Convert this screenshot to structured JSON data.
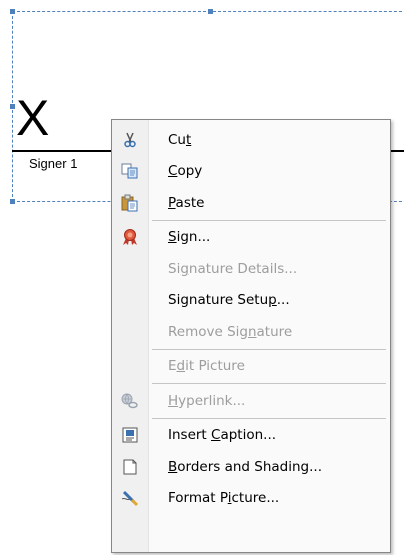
{
  "signature": {
    "mark": "X",
    "signer_label": "Signer 1"
  },
  "menu": {
    "items": [
      {
        "label": "Cut",
        "accel": "t",
        "icon": "scissors-icon",
        "enabled": true
      },
      {
        "label": "Copy",
        "accel": "C",
        "icon": "copy-icon",
        "enabled": true
      },
      {
        "label": "Paste",
        "accel": "P",
        "icon": "paste-icon",
        "enabled": true
      },
      {
        "label": "Sign...",
        "accel": "S",
        "icon": "sign-ribbon-icon",
        "enabled": true
      },
      {
        "label": "Signature Details...",
        "accel": "g",
        "icon": "",
        "enabled": false
      },
      {
        "label": "Signature Setup...",
        "accel": "p",
        "icon": "",
        "enabled": true
      },
      {
        "label": "Remove Signature",
        "accel": "n",
        "icon": "",
        "enabled": false
      },
      {
        "label": "Edit Picture",
        "accel": "d",
        "icon": "",
        "enabled": false
      },
      {
        "label": "Hyperlink...",
        "accel": "H",
        "icon": "hyperlink-icon",
        "enabled": false
      },
      {
        "label": "Insert Caption...",
        "accel": "C",
        "icon": "insert-caption-icon",
        "enabled": true
      },
      {
        "label": "Borders and Shading...",
        "accel": "B",
        "icon": "borders-icon",
        "enabled": true
      },
      {
        "label": "Format Picture...",
        "accel": "i",
        "icon": "format-picture-icon",
        "enabled": true
      }
    ]
  },
  "colors": {
    "selection_border": "#4f81bd",
    "disabled_text": "#9d9d9d"
  }
}
